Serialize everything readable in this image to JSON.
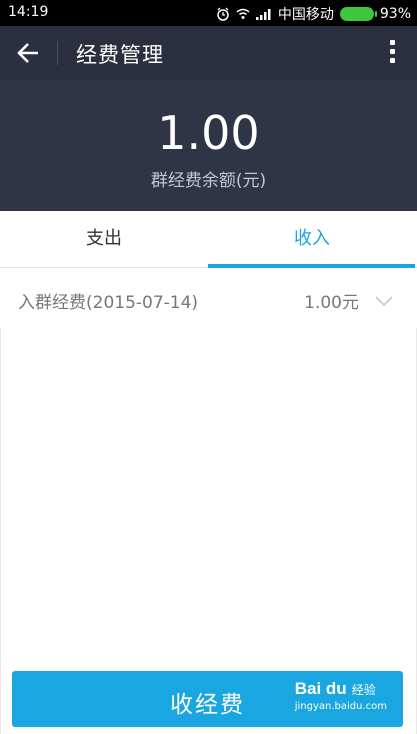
{
  "status_bar": {
    "time": "14:19",
    "carrier": "中国移动",
    "battery": "93%",
    "icons": [
      "alarm-icon",
      "wifi-icon",
      "signal-icon",
      "battery-icon"
    ]
  },
  "title_bar": {
    "title": "经费管理",
    "back_icon": "arrow-left-icon",
    "more_icon": "more-vertical-icon"
  },
  "balance": {
    "amount": "1.00",
    "label": "群经费余额(元)"
  },
  "tabs": [
    {
      "label": "支出",
      "selected": false
    },
    {
      "label": "收入",
      "selected": true
    }
  ],
  "records": [
    {
      "title": "入群经费(2015-07-14)",
      "amount": "1.00元",
      "icon": "chevron-down-icon"
    }
  ],
  "collect_button": {
    "label": "收经费"
  },
  "watermark": {
    "logo": "Bai du",
    "sub": "经验",
    "url": "jingyan.baidu.com"
  },
  "colors": {
    "accent": "#1aa6e0",
    "header": "#2b2f3f",
    "balance_bg": "#2f3446"
  }
}
